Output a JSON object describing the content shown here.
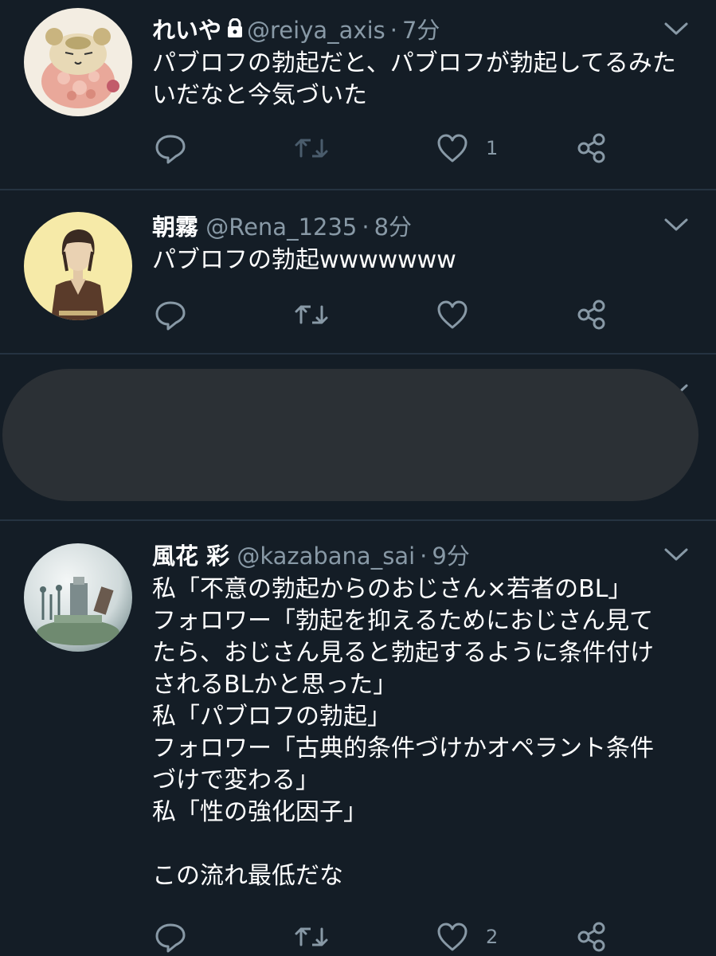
{
  "colors": {
    "background": "#141d26",
    "divider": "#253341",
    "secondary_text": "#8899a6",
    "primary_text": "#ffffff",
    "icon": "#8899a6",
    "redaction": "#2b3035"
  },
  "tweets": [
    {
      "name": "れいや",
      "locked": true,
      "handle": "@reiya_axis",
      "separator": "·",
      "time": "7分",
      "text": "パブロフの勃起だと、パブロフが勃起してるみたいだなと今気づいた",
      "reply_icon": "reply-icon",
      "retweet_icon": "retweet-icon",
      "like_icon": "heart-icon",
      "like_count": "1",
      "share_icon": "share-icon"
    },
    {
      "name": "朝霧",
      "locked": false,
      "handle": "@Rena_1235",
      "separator": "·",
      "time": "8分",
      "text": "パブロフの勃起wwwwwww",
      "reply_icon": "reply-icon",
      "retweet_icon": "retweet-icon",
      "like_icon": "heart-icon",
      "like_count": "",
      "share_icon": "share-icon"
    },
    {
      "redacted": true
    },
    {
      "name": "風花 彩",
      "locked": false,
      "handle": "@kazabana_sai",
      "separator": "·",
      "time": "9分",
      "text_lines": [
        "私「不意の勃起からのおじさん×若者のBL」",
        "フォロワー「勃起を抑えるためにおじさん見て",
        "たら、おじさん見ると勃起するように条件付け",
        "されるBLかと思った」",
        "私「パブロフの勃起」",
        "フォロワー「古典的条件づけかオペラント条件",
        "づけで変わる」",
        "私「性の強化因子」",
        "",
        "この流れ最低だな"
      ],
      "reply_icon": "reply-icon",
      "retweet_icon": "retweet-icon",
      "like_icon": "heart-icon",
      "like_count": "2",
      "share_icon": "share-icon"
    }
  ]
}
